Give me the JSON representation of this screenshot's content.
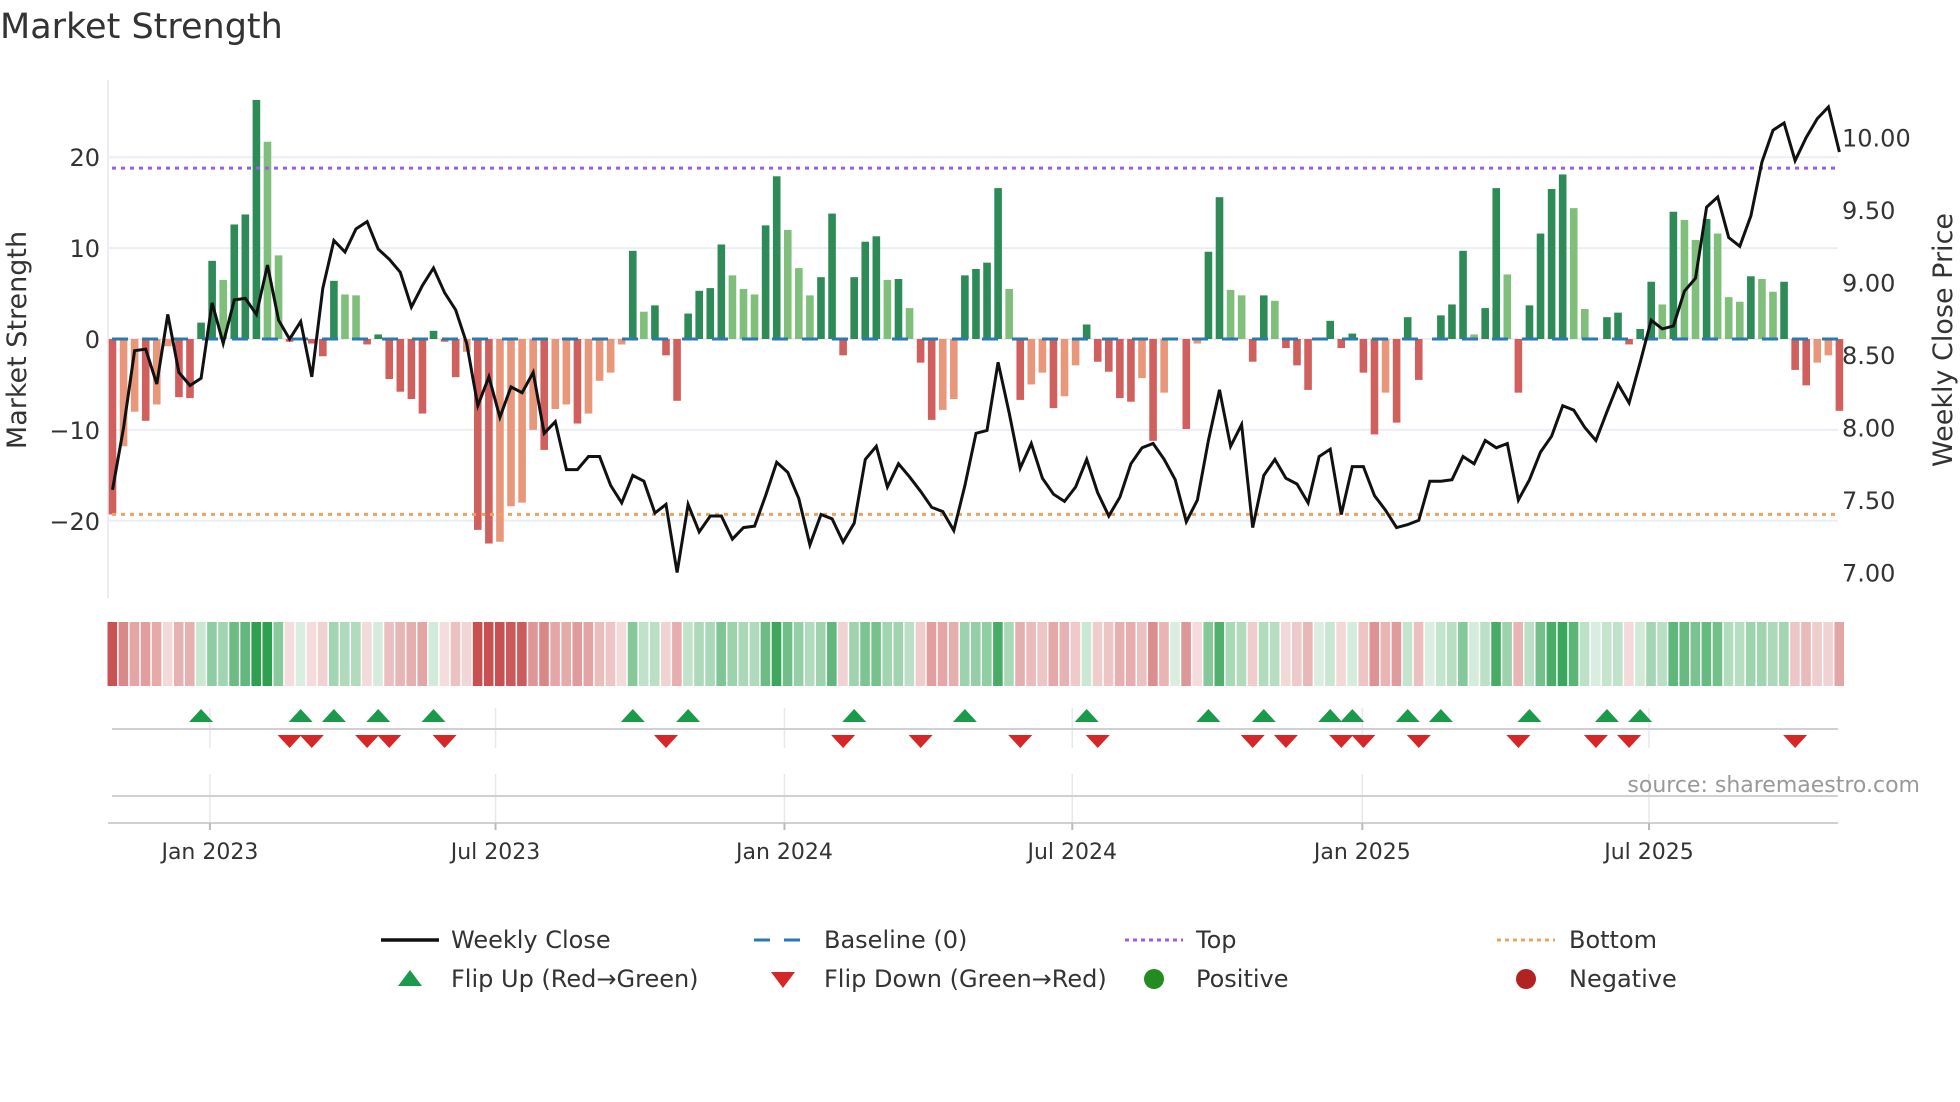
{
  "chart_data": {
    "type": "bar",
    "title": "Market Strength",
    "ylabel": "Market Strength",
    "y2label": "Weekly Close Price",
    "ylim": [
      -29,
      28
    ],
    "y2lim": [
      6.8,
      10.35
    ],
    "yticks": [
      "20",
      "10",
      "0",
      "−10",
      "−20"
    ],
    "ytick_values": [
      20,
      10,
      0,
      -10,
      -20
    ],
    "y2ticks": [
      "10.00",
      "9.50",
      "9.00",
      "8.50",
      "8.00",
      "7.50",
      "7.00"
    ],
    "y2tick_values": [
      10,
      9.5,
      9,
      8.5,
      8,
      7.5,
      7
    ],
    "xticks": [
      "Jan 2023",
      "Jul 2023",
      "Jan 2024",
      "Jul 2024",
      "Jan 2025",
      "Jul 2025"
    ],
    "xtick_week_index": [
      8.8,
      34.6,
      60.7,
      86.7,
      112.9,
      138.8
    ],
    "top_level": 18.8,
    "bottom_level": -19.3,
    "baseline": 0,
    "strength": [
      -19.3,
      -11.8,
      -8,
      -9,
      -7.2,
      -0.8,
      -6.4,
      -6.5,
      1.8,
      8.6,
      6.5,
      12.6,
      13.7,
      26.3,
      21.7,
      9.2,
      -0.3,
      0,
      -0.5,
      -1.9,
      6.4,
      4.9,
      4.8,
      -0.6,
      0.5,
      -4.4,
      -5.8,
      -6.6,
      -8.2,
      0.9,
      -0.3,
      -4.2,
      -1.4,
      -21,
      -22.5,
      -22.3,
      -18.4,
      -18,
      -10,
      -12.2,
      -7.7,
      -7.2,
      -9.3,
      -8.2,
      -4.6,
      -3.7,
      -0.6,
      9.7,
      3,
      3.7,
      -1.8,
      -6.8,
      2.8,
      5.3,
      5.6,
      10.4,
      7,
      5.5,
      4.9,
      12.5,
      17.9,
      12,
      7.8,
      4.8,
      6.8,
      13.8,
      -1.8,
      6.8,
      10.7,
      11.3,
      6.5,
      6.6,
      3.4,
      -2.6,
      -8.9,
      -7.8,
      -6.6,
      7,
      7.7,
      8.4,
      16.6,
      5.5,
      -6.7,
      -5,
      -3.7,
      -7.6,
      -6.3,
      -2.9,
      1.6,
      -2.5,
      -3.6,
      -6.5,
      -6.9,
      -4.3,
      -11.2,
      -5.9,
      0,
      -9.9,
      -0.5,
      9.6,
      15.6,
      5.4,
      4.8,
      -2.5,
      4.8,
      4.2,
      -1,
      -2.9,
      -5.6,
      0,
      2,
      -1,
      0.6,
      -3.7,
      -10.5,
      -5.9,
      -9.2,
      2.4,
      -4.5,
      0,
      2.6,
      3.8,
      9.7,
      0.5,
      3.4,
      16.6,
      7.1,
      -5.9,
      3.7,
      11.6,
      16.5,
      18.1,
      14.4,
      3.3,
      0,
      2.4,
      2.9,
      -0.6,
      1.1,
      6.3,
      3.8,
      14,
      13.1,
      10.9,
      13.2,
      11.6,
      4.6,
      4.1,
      6.9,
      6.6,
      5.2,
      6.3,
      -3.4,
      -5.1,
      -2.6,
      -1.8,
      -7.9
    ],
    "weekly_close": [
      7.57,
      8,
      8.53,
      8.54,
      8.3,
      8.78,
      8.38,
      8.29,
      8.34,
      8.86,
      8.58,
      8.88,
      8.89,
      8.78,
      9.12,
      8.74,
      8.61,
      8.73,
      8.35,
      8.96,
      9.29,
      9.21,
      9.37,
      9.42,
      9.23,
      9.16,
      9.07,
      8.83,
      8.98,
      9.1,
      8.93,
      8.81,
      8.58,
      8.15,
      8.35,
      8.07,
      8.28,
      8.24,
      8.38,
      7.96,
      8.04,
      7.71,
      7.71,
      7.8,
      7.8,
      7.6,
      7.48,
      7.67,
      7.63,
      7.41,
      7.47,
      7,
      7.47,
      7.28,
      7.39,
      7.39,
      7.23,
      7.31,
      7.32,
      7.53,
      7.76,
      7.69,
      7.51,
      7.19,
      7.4,
      7.37,
      7.21,
      7.34,
      7.78,
      7.87,
      7.59,
      7.75,
      7.66,
      7.56,
      7.45,
      7.42,
      7.29,
      7.6,
      7.96,
      7.98,
      8.45,
      8.1,
      7.72,
      7.89,
      7.65,
      7.54,
      7.49,
      7.59,
      7.78,
      7.55,
      7.39,
      7.52,
      7.75,
      7.86,
      7.89,
      7.78,
      7.64,
      7.35,
      7.5,
      7.91,
      8.26,
      7.87,
      8.02,
      7.31,
      7.67,
      7.78,
      7.65,
      7.61,
      7.48,
      7.8,
      7.85,
      7.4,
      7.73,
      7.73,
      7.53,
      7.43,
      7.31,
      7.33,
      7.36,
      7.63,
      7.63,
      7.64,
      7.8,
      7.75,
      7.91,
      7.86,
      7.89,
      7.5,
      7.64,
      7.83,
      7.94,
      8.15,
      8.12,
      8,
      7.91,
      8.11,
      8.3,
      8.17,
      8.45,
      8.74,
      8.68,
      8.7,
      8.94,
      9.03,
      9.52,
      9.59,
      9.31,
      9.25,
      9.46,
      9.83,
      10.05,
      10.1,
      9.84,
      10,
      10.13,
      10.21,
      9.9
    ],
    "flip_up_week_index": [
      8,
      17,
      20,
      24,
      29,
      47,
      52,
      67,
      77,
      88,
      99,
      104,
      110,
      112,
      117,
      120,
      128,
      135,
      138
    ],
    "flip_down_week_index": [
      16,
      18,
      23,
      25,
      30,
      50,
      66,
      73,
      82,
      89,
      103,
      106,
      111,
      113,
      118,
      127,
      134,
      137,
      152
    ],
    "legend": [
      {
        "label": "Weekly Close",
        "kind": "line"
      },
      {
        "label": "Baseline (0)",
        "kind": "dash"
      },
      {
        "label": "Top",
        "kind": "dot-top"
      },
      {
        "label": "Bottom",
        "kind": "dot-bottom"
      },
      {
        "label": "Flip Up (Red→Green)",
        "kind": "tri-up"
      },
      {
        "label": "Flip Down (Green→Red)",
        "kind": "tri-down"
      },
      {
        "label": "Positive",
        "kind": "dot-pos"
      },
      {
        "label": "Negative",
        "kind": "dot-neg"
      }
    ],
    "legend_placement": "bottom",
    "source": "source: sharemaestro.com"
  },
  "colors": {
    "pos_strong": "#2e8b57",
    "pos_weak": "#7fbf7b",
    "neg_strong": "#d0605e",
    "neg_weak": "#e8977a",
    "line": "#111111",
    "baseline": "#2a7ab0",
    "top": "#9b5de5",
    "bottom": "#f0a35e",
    "flip_up": "#1a9a4a",
    "flip_down": "#d62728",
    "positive": "#228b22",
    "negative": "#b22222"
  }
}
